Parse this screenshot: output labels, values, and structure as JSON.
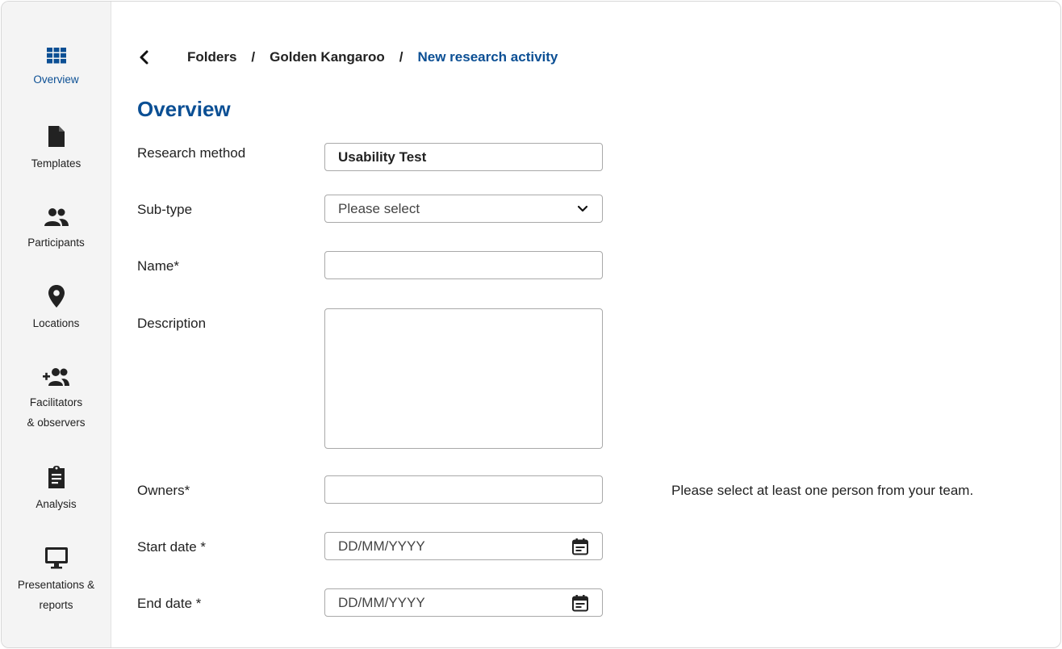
{
  "sidebar": {
    "items": [
      {
        "label": "Overview",
        "icon": "grid-icon",
        "active": true
      },
      {
        "label": "Templates",
        "icon": "file-icon"
      },
      {
        "label": "Participants",
        "icon": "people-icon"
      },
      {
        "label": "Locations",
        "icon": "location-pin-icon"
      },
      {
        "label": "Facilitators",
        "label2": "& observers",
        "icon": "add-people-icon"
      },
      {
        "label": "Analysis",
        "icon": "clipboard-icon"
      },
      {
        "label": "Presentations &",
        "label2": "reports",
        "icon": "monitor-icon"
      }
    ]
  },
  "breadcrumb": {
    "items": [
      "Folders",
      "Golden Kangaroo",
      "New research activity"
    ],
    "separator": "/"
  },
  "page": {
    "title": "Overview"
  },
  "form": {
    "research_method": {
      "label": "Research method",
      "value": "Usability Test"
    },
    "sub_type": {
      "label": "Sub-type",
      "placeholder": "Please select"
    },
    "name": {
      "label": "Name*",
      "value": ""
    },
    "description": {
      "label": "Description",
      "value": ""
    },
    "owners": {
      "label": "Owners*",
      "value": "",
      "helper": "Please select at least one person from your team."
    },
    "start_date": {
      "label": "Start date *",
      "placeholder": "DD/MM/YYYY"
    },
    "end_date": {
      "label": "End date *",
      "placeholder": "DD/MM/YYYY"
    }
  },
  "colors": {
    "accent": "#0b4f94",
    "sidebar_bg": "#f4f4f4",
    "border": "#a9a9a9"
  }
}
